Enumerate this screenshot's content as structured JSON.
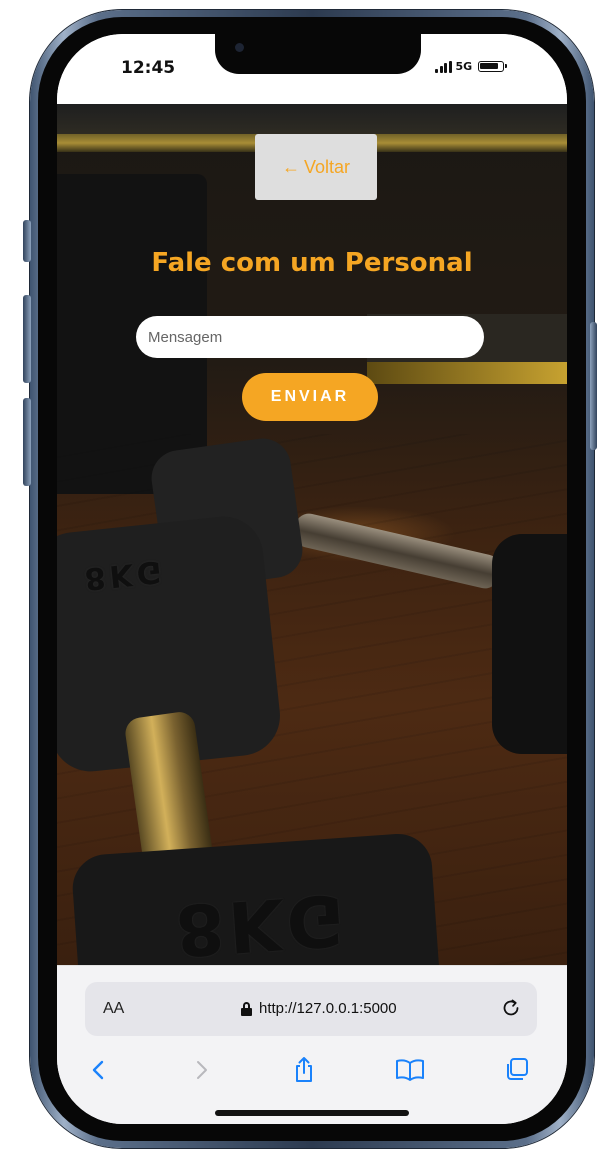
{
  "status_bar": {
    "time": "12:45",
    "network": "5G"
  },
  "page": {
    "back_label": "Voltar",
    "back_icon": "arrow-left-icon",
    "title": "Fale com um Personal",
    "message_placeholder": "Mensagem",
    "send_label": "ENVIAR",
    "background_image": "dumbbells-on-wooden-floor",
    "plate_marking": "8KG"
  },
  "browser": {
    "text_size_label": "AA",
    "url": "http://127.0.0.1:5000",
    "toolbar": [
      "back-icon",
      "forward-icon",
      "share-icon",
      "bookmarks-icon",
      "tabs-icon"
    ]
  },
  "colors": {
    "accent": "#f5a623",
    "back_button_bg": "#dedede",
    "ios_blue": "#1a82fb",
    "browser_bar_bg": "#f3f3f5"
  }
}
